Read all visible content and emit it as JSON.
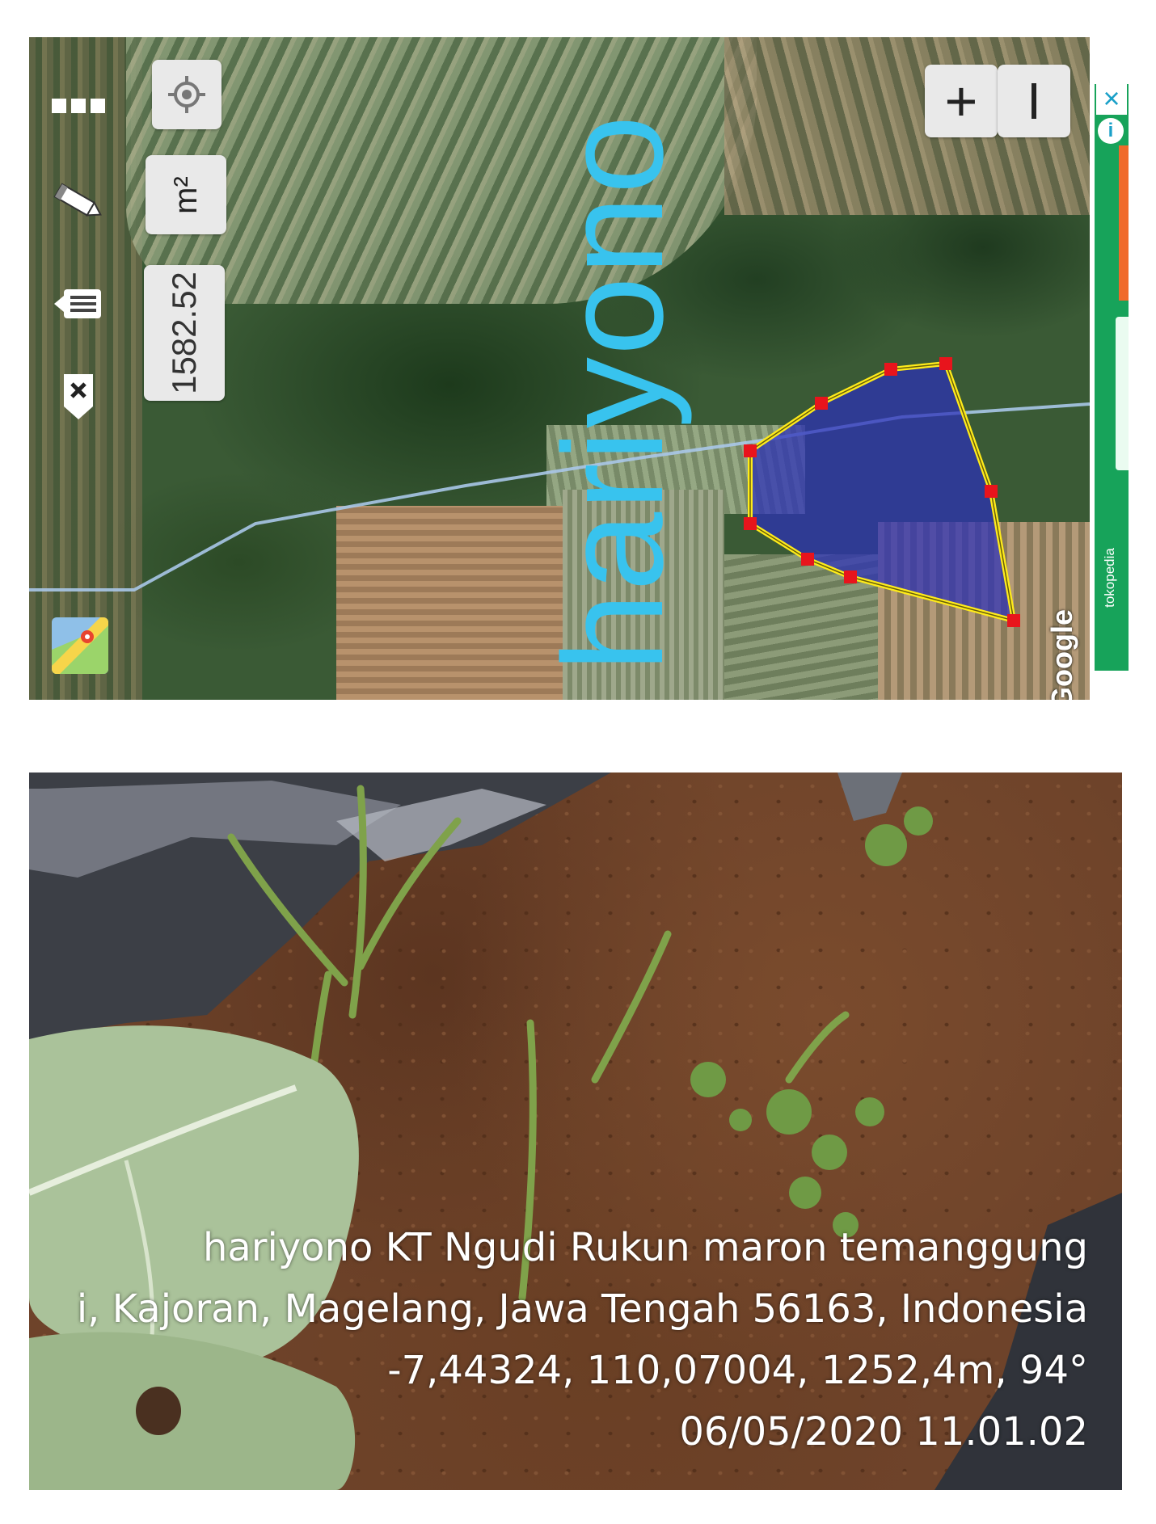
{
  "map": {
    "zoom_in_label": "+",
    "zoom_out_label": "I",
    "unit_label": "m²",
    "area_value": "1582.52",
    "watermark": "hariyono",
    "attribution": "Google",
    "icons": [
      "menu-icon",
      "pencil-icon",
      "list-icon",
      "delete-pin-icon",
      "locate-icon",
      "app-logo-icon"
    ],
    "polygon_fill_color": "#2b2fb8",
    "polygon_stroke_color": "#ffeb1a",
    "vertex_color": "#e8141c",
    "watermark_color": "#38c3ee"
  },
  "ad": {
    "brand": "tokopedia",
    "close_icon": "close-icon",
    "info_icon": "info-icon",
    "color": "#17a35a"
  },
  "photo": {
    "caption_line1": "hariyono KT Ngudi Rukun maron temanggung",
    "caption_line2": "i, Kajoran, Magelang, Jawa Tengah 56163, Indonesia",
    "caption_line3": "-7,44324, 110,07004, 1252,4m, 94°",
    "caption_line4": "06/05/2020 11.01.02"
  }
}
